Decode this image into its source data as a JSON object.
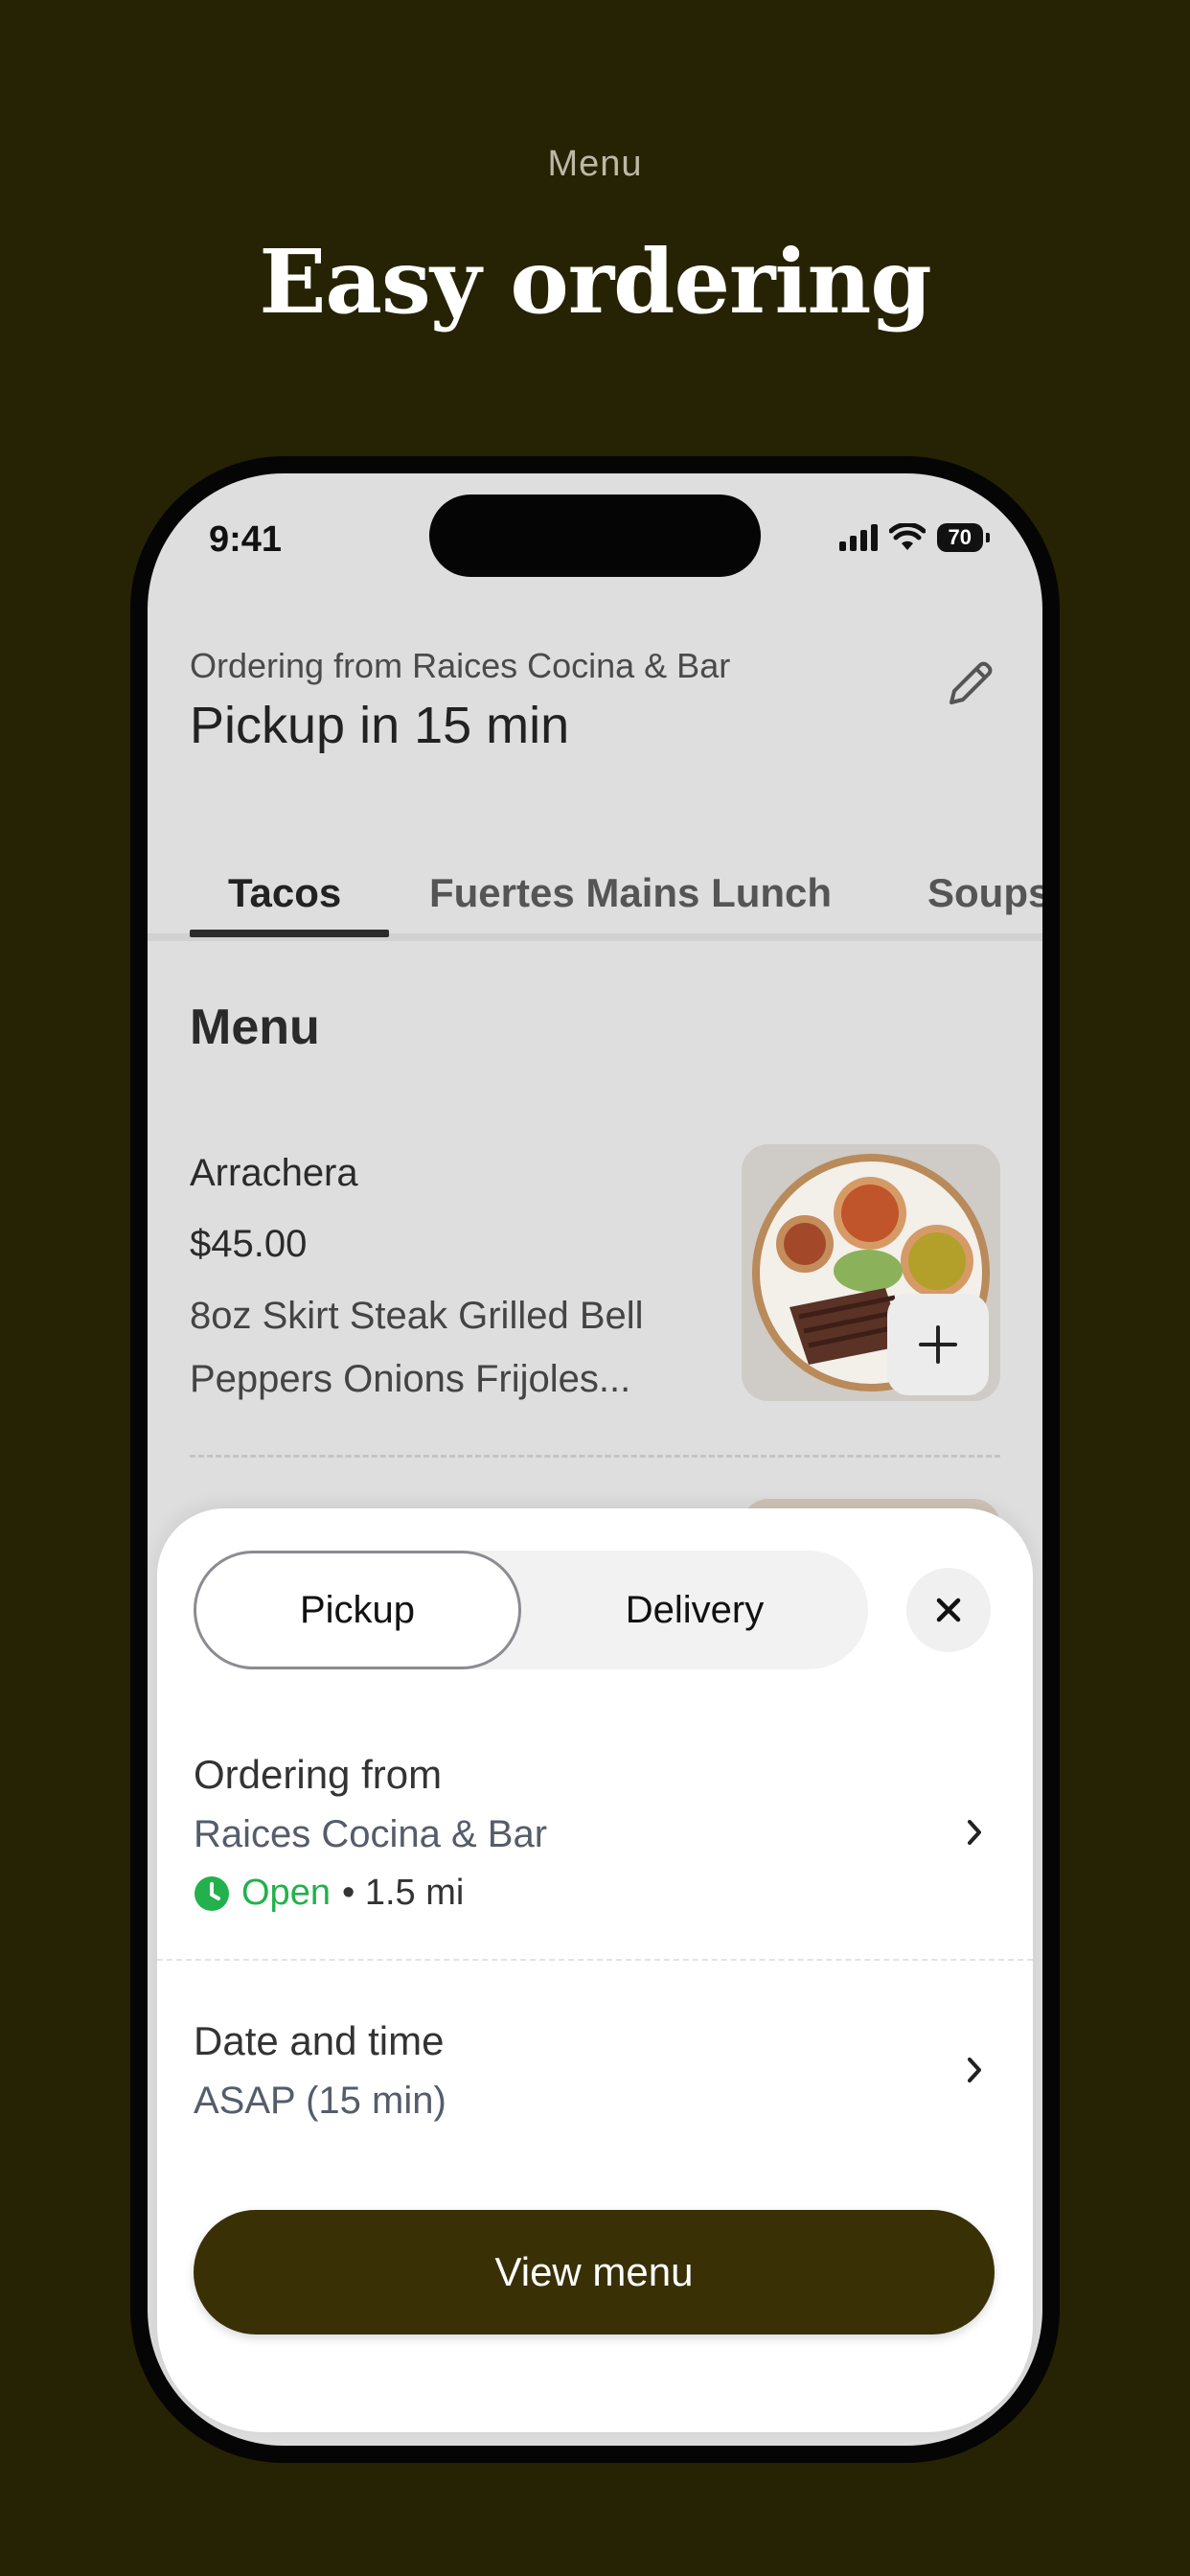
{
  "marketing": {
    "eyebrow": "Menu",
    "headline": "Easy ordering"
  },
  "status_bar": {
    "time": "9:41",
    "battery": "70"
  },
  "header": {
    "ordering_from": "Ordering from Raices Cocina & Bar",
    "pickup_title": "Pickup in 15 min"
  },
  "tabs": [
    {
      "label": "Tacos",
      "active": true
    },
    {
      "label": "Fuertes Mains Lunch",
      "active": false
    },
    {
      "label": "Soups",
      "active": false
    }
  ],
  "menu": {
    "heading": "Menu",
    "items": [
      {
        "name": "Arrachera",
        "price": "$45.00",
        "description": "8oz Skirt Steak Grilled Bell Peppers Onions Frijoles..."
      }
    ]
  },
  "sheet": {
    "segment": {
      "pickup": "Pickup",
      "delivery": "Delivery",
      "selected": "Pickup"
    },
    "ordering_from_label": "Ordering from",
    "restaurant": "Raices Cocina & Bar",
    "open_status": "Open",
    "distance": "• 1.5 mi",
    "datetime_label": "Date and time",
    "datetime_value": "ASAP (15 min)",
    "view_menu": "View menu"
  },
  "colors": {
    "background": "#262204",
    "primary_button": "#3a3006",
    "open_green": "#22b14c"
  },
  "icons": {
    "edit": "pencil-icon",
    "close": "close-icon",
    "chevron": "chevron-right-icon",
    "clock": "clock-icon",
    "add": "plus-icon"
  }
}
